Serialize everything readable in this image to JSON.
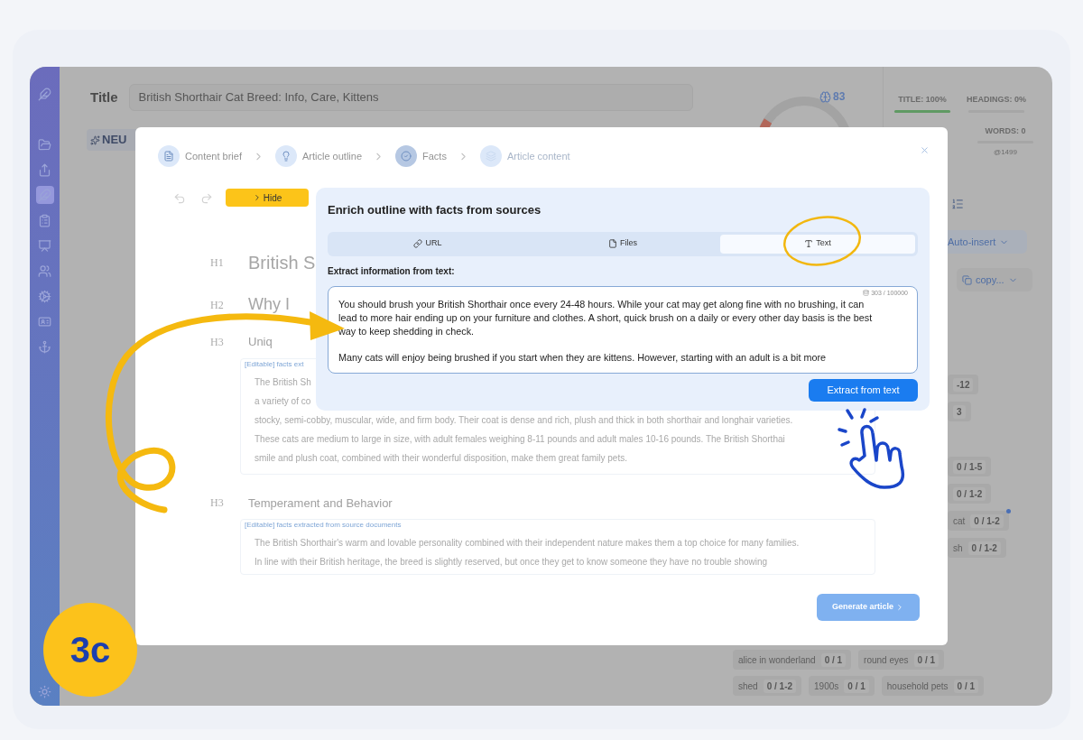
{
  "sidebar": {
    "items": [
      {
        "selected": false
      },
      {
        "selected": false
      },
      {
        "selected": false
      },
      {
        "selected": true
      },
      {
        "selected": false
      },
      {
        "selected": false
      },
      {
        "selected": false
      },
      {
        "selected": false
      },
      {
        "selected": false
      },
      {
        "selected": false
      },
      {
        "selected": false
      }
    ]
  },
  "header": {
    "title_label": "Title",
    "title_value": "British Shorthair Cat Breed: Info, Care, Kittens",
    "brand": "NEU",
    "score": "83"
  },
  "stats": {
    "tabs": [
      {
        "label": "TITLE: 100%",
        "level": 1
      },
      {
        "label": "HEADINGS: 0%",
        "level": 0
      }
    ],
    "words": {
      "label": "WORDS: 0",
      "level": 0,
      "target": "@1499"
    }
  },
  "actions": {
    "auto_insert": "Auto-insert",
    "copy": "copy..."
  },
  "keywords_side": [
    {
      "count": "-12"
    },
    {
      "count": "3"
    },
    {
      "count": "0 / 1-5"
    },
    {
      "count": "0 / 1-2"
    },
    {
      "label": "cat",
      "count": "0 / 1-2",
      "flagged": true
    },
    {
      "label": "sh",
      "count": "0 / 1-2",
      "flagged": false
    }
  ],
  "keywords_bottom": [
    [
      {
        "label": "alice in wonderland",
        "count": "0 / 1"
      },
      {
        "label": "round eyes",
        "count": "0 / 1"
      }
    ],
    [
      {
        "label": "shed",
        "count": "0 / 1-2"
      },
      {
        "label": "1900s",
        "count": "0 / 1"
      },
      {
        "label": "household pets",
        "count": "0 / 1"
      }
    ]
  ],
  "modal": {
    "steps": [
      {
        "label": "Content brief",
        "selected": false,
        "disabled": false
      },
      {
        "label": "Article outline",
        "selected": false,
        "disabled": false
      },
      {
        "label": "Facts",
        "selected": true,
        "disabled": false
      },
      {
        "label": "Article content",
        "selected": false,
        "disabled": true
      }
    ],
    "hide_button": "Hide",
    "outline": [
      {
        "level": "H1",
        "text": "British S"
      },
      {
        "level": "H2",
        "text": "Why I"
      },
      {
        "level": "H3",
        "text": "Uniq",
        "facts": {
          "label": "[Editable] facts ext",
          "lines": [
            "The British Sh",
            "a variety of co",
            "stocky, semi-cobby, muscular, wide, and firm body. Their coat is dense and rich, plush and thick in both shorthair and longhair varieties.",
            "These cats are medium to large in size, with adult females weighing 8-11 pounds and adult males 10-16 pounds. The British Shorthai",
            "smile and plush coat, combined with their wonderful disposition, make them great family pets."
          ]
        }
      },
      {
        "level": "H3",
        "text": "Temperament and Behavior",
        "facts": {
          "label": "[Editable] facts extracted from source documents",
          "lines": [
            "The British Shorthair's warm and lovable personality combined with their independent nature makes them a top choice for many families.",
            "In line with their British heritage, the breed is slightly reserved, but once they get to know someone they have no trouble showing"
          ]
        }
      }
    ],
    "generate_button": {
      "label": "Generate article",
      "disabled": true
    },
    "panel": {
      "title": "Enrich outline with facts from sources",
      "tabs": [
        {
          "label": "URL",
          "selected": false
        },
        {
          "label": "Files",
          "selected": false
        },
        {
          "label": "Text",
          "selected": true
        }
      ],
      "field_label": "Extract information from text:",
      "paragraphs": [
        [
          "You should brush your British Shorthair once every 24-48 hours. While your cat may get along fine with no brushing, it can",
          "lead to more hair ending up on your furniture and clothes. A short, quick brush on a daily or every other day basis is the best",
          "way to keep shedding in check."
        ],
        [
          "Many cats will enjoy being brushed if you start when they are kittens. However, starting with an adult is a bit more"
        ]
      ],
      "counter": "303 / 100000",
      "extract_button": "Extract from text"
    }
  },
  "badge": "3c"
}
